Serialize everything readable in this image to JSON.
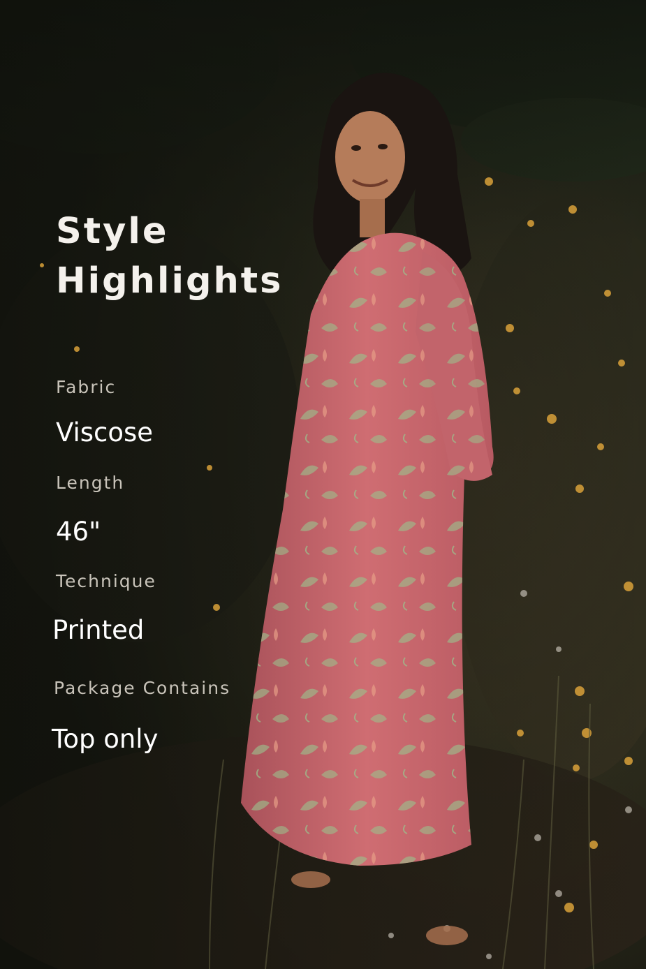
{
  "heading": {
    "line1": "Style",
    "line2": "Highlights"
  },
  "specs": [
    {
      "label": "Fabric",
      "value": "Viscose"
    },
    {
      "label": "Length",
      "value": "46\""
    },
    {
      "label": "Technique",
      "value": "Printed"
    },
    {
      "label": "Package Contains",
      "value": "Top only"
    }
  ],
  "colors": {
    "background_dark": "#1e1f17",
    "foliage": "#3a3a2a",
    "flower_yellow": "#d9a13a",
    "dress_pink": "#c8666c",
    "leaf_print": "#9bbf8c",
    "hair": "#1a1411",
    "skin": "#b57c5a"
  }
}
